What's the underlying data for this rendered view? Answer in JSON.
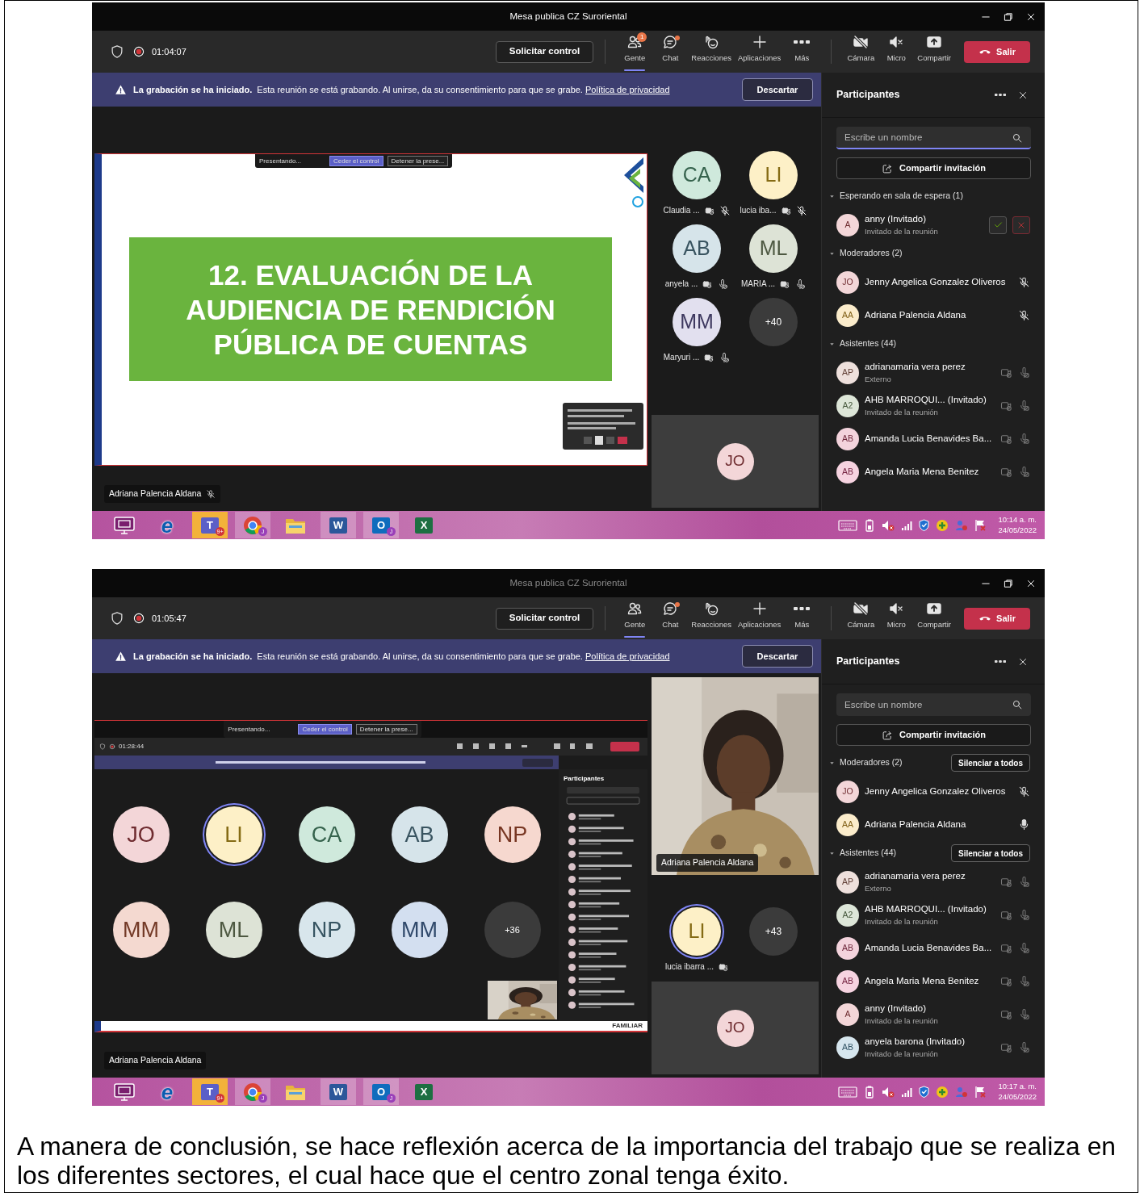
{
  "windows": [
    {
      "title": "Mesa publica CZ Suroriental",
      "active": true,
      "timer": "01:04:07",
      "control_button": "Solicitar control",
      "tools": [
        {
          "label": "Gente",
          "badge": "1",
          "unread": false,
          "selected": true
        },
        {
          "label": "Chat",
          "unread": true,
          "selected": false
        },
        {
          "label": "Reacciones",
          "unread": false,
          "selected": false
        },
        {
          "label": "Aplicaciones",
          "unread": false,
          "selected": false
        },
        {
          "label": "Más",
          "unread": false,
          "selected": false
        }
      ],
      "devices": [
        {
          "label": "Cámara"
        },
        {
          "label": "Micro"
        },
        {
          "label": "Compartir"
        }
      ],
      "leave_button": "Salir",
      "banner": {
        "title": "La grabación se ha iniciado.",
        "text": "Esta reunión se está grabando. Al unirse, da su consentimiento para que se grabe.",
        "link": "Política de privacidad",
        "button": "Descartar"
      },
      "stage": {
        "kind": "slide",
        "presenter_bar": {
          "label": "Presentando...",
          "buttons": [
            "Ceder el control",
            "Detener la prese..."
          ]
        },
        "heading": "12. EVALUACIÓN DE LA AUDIENCIA DE RENDICIÓN PÚBLICA DE CUENTAS"
      },
      "name_tag": {
        "name": "Adriana Palencia Aldana",
        "muted": true
      },
      "side": [
        {
          "kind": "grid",
          "overflow": "+40",
          "tiles": [
            {
              "initials": "CA",
              "name": "Claudia ...",
              "color": "#cfe9dc",
              "muted": true,
              "speaking": false
            },
            {
              "initials": "LI",
              "name": "lucia iba...",
              "color": "#fdf0c7",
              "muted": true,
              "speaking": false
            },
            {
              "initials": "AB",
              "name": "anyela ...",
              "color": "#d6e4ea",
              "muted": false,
              "speaking": false
            },
            {
              "initials": "ML",
              "name": "MARIA ...",
              "color": "#dde3d6",
              "muted": false,
              "speaking": false
            },
            {
              "initials": "MM",
              "name": "Maryuri ...",
              "color": "#e2e0ef",
              "muted": false,
              "speaking": false
            }
          ]
        },
        {
          "kind": "self",
          "initials": "JO",
          "color": "#f3d6d8"
        }
      ],
      "panel": {
        "title": "Participantes",
        "search": {
          "placeholder": "Escribe un nombre",
          "focused": true
        },
        "share_button": "Compartir invitación",
        "sections": [
          {
            "title": "Esperando en sala de espera (1)",
            "expanded": true,
            "people": [
              {
                "kind": "waiting",
                "initials": "A",
                "name": "anny (Invitado)",
                "role": "Invitado de la reunión",
                "color": "#f3d6d8"
              }
            ]
          },
          {
            "title": "Moderadores (2)",
            "expanded": true,
            "people": [
              {
                "kind": "moderator",
                "initials": "JO",
                "name": "Jenny Angelica Gonzalez Oliveros",
                "color": "#f3d6d8",
                "muted": true
              },
              {
                "kind": "moderator",
                "initials": "AA",
                "name": "Adriana Palencia Aldana",
                "color": "#fbeccb",
                "muted": true
              }
            ]
          },
          {
            "title": "Asistentes (44)",
            "expanded": true,
            "people": [
              {
                "kind": "attendee",
                "initials": "AP",
                "name": "adrianamaria vera perez",
                "role": "Externo",
                "color": "#eee0dc"
              },
              {
                "kind": "attendee",
                "initials": "A2",
                "name": "AHB MARROQUI... (Invitado)",
                "role": "Invitado de la reunión",
                "color": "#dde6d8"
              },
              {
                "kind": "attendee",
                "initials": "AB",
                "name": "Amanda Lucia Benavides Ba...",
                "color": "#f3d3dc"
              },
              {
                "kind": "attendee",
                "initials": "AB",
                "name": "Angela Maria Mena Benitez",
                "color": "#f6d3e0"
              }
            ]
          }
        ]
      },
      "taskbar": {
        "time": "10:14 a. m.",
        "date": "24/05/2022",
        "apps": [
          {
            "kind": "monitor",
            "running": false,
            "selected": false
          },
          {
            "kind": "glyph",
            "glyph": "e",
            "color": "#0b5cb0",
            "running": false,
            "selected": false
          },
          {
            "kind": "tile",
            "glyph": "T",
            "badge": "9+",
            "color": "#5b5fc7",
            "running": true,
            "selected": true
          },
          {
            "kind": "wheel",
            "badge": "J",
            "running": true,
            "selected": false
          },
          {
            "kind": "folder",
            "running": false,
            "selected": false
          },
          {
            "kind": "tile",
            "glyph": "W",
            "color": "#2b579a",
            "running": true,
            "selected": false
          },
          {
            "kind": "tile",
            "glyph": "O",
            "badge": "J",
            "color": "#0f6cbd",
            "running": true,
            "selected": false
          },
          {
            "kind": "tile",
            "glyph": "X",
            "color": "#1d6f42",
            "running": false,
            "selected": false
          }
        ]
      }
    },
    {
      "title": "Mesa publica CZ Suroriental",
      "active": false,
      "timer": "01:05:47",
      "control_button": "Solicitar control",
      "tools": [
        {
          "label": "Gente",
          "unread": false,
          "selected": true
        },
        {
          "label": "Chat",
          "unread": true,
          "selected": false
        },
        {
          "label": "Reacciones",
          "unread": false,
          "selected": false
        },
        {
          "label": "Aplicaciones",
          "unread": false,
          "selected": false
        },
        {
          "label": "Más",
          "unread": false,
          "selected": false
        }
      ],
      "devices": [
        {
          "label": "Cámara"
        },
        {
          "label": "Micro"
        },
        {
          "label": "Compartir"
        }
      ],
      "leave_button": "Salir",
      "banner": {
        "title": "La grabación se ha iniciado.",
        "text": "Esta reunión se está grabando. Al unirse, da su consentimiento para que se grabe.",
        "link": "Política de privacidad",
        "button": "Descartar"
      },
      "stage": {
        "kind": "shared_screen",
        "presenter_bar": {
          "label": "Presentando...",
          "buttons": [
            "Ceder el control",
            "Detener la prese..."
          ]
        },
        "timer": "01:28:44",
        "panel_title": "Participantes",
        "overflow": "+36",
        "footer": "FAMILIAR",
        "tiles": [
          {
            "initials": "JO",
            "color": "#f3d6d8",
            "speaking": false
          },
          {
            "initials": "LI",
            "color": "#fdf0c7",
            "speaking": true
          },
          {
            "initials": "CA",
            "color": "#cfe9dc",
            "speaking": false
          },
          {
            "initials": "AB",
            "color": "#d6e4ea",
            "speaking": false
          },
          {
            "initials": "NP",
            "color": "#f6d8cf",
            "speaking": false
          },
          {
            "initials": "MM",
            "color": "#f4d9d0",
            "speaking": false
          },
          {
            "initials": "ML",
            "color": "#dde3d6",
            "speaking": false
          },
          {
            "initials": "NP",
            "color": "#d8e6ec",
            "speaking": false
          },
          {
            "initials": "MM",
            "color": "#d3dff0",
            "speaking": false
          }
        ]
      },
      "name_tag": {
        "name": "Adriana Palencia Aldana",
        "muted": false
      },
      "side": [
        {
          "kind": "video",
          "name": "Adriana Palencia Aldana"
        },
        {
          "kind": "grid",
          "overflow": "+43",
          "tiles": [
            {
              "initials": "LI",
              "name": "lucia ibarra ...",
              "color": "#fdf0c7",
              "speaking": true
            }
          ]
        },
        {
          "kind": "self",
          "initials": "JO",
          "color": "#f3d6d8"
        }
      ],
      "panel": {
        "title": "Participantes",
        "search": {
          "placeholder": "Escribe un nombre",
          "focused": false
        },
        "share_button": "Compartir invitación",
        "sections": [
          {
            "title": "Moderadores (2)",
            "expanded": true,
            "action": "Silenciar a todos",
            "people": [
              {
                "kind": "moderator",
                "initials": "JO",
                "name": "Jenny Angelica Gonzalez Oliveros",
                "color": "#f3d6d8",
                "muted": true
              },
              {
                "kind": "moderator",
                "initials": "AA",
                "name": "Adriana Palencia Aldana",
                "color": "#fbeccb",
                "muted": false
              }
            ]
          },
          {
            "title": "Asistentes (44)",
            "expanded": true,
            "action": "Silenciar a todos",
            "people": [
              {
                "kind": "attendee",
                "initials": "AP",
                "name": "adrianamaria vera perez",
                "role": "Externo",
                "color": "#eee0dc"
              },
              {
                "kind": "attendee",
                "initials": "A2",
                "name": "AHB MARROQUI... (Invitado)",
                "role": "Invitado de la reunión",
                "color": "#dde6d8"
              },
              {
                "kind": "attendee",
                "initials": "AB",
                "name": "Amanda Lucia Benavides Ba...",
                "color": "#f3d3dc"
              },
              {
                "kind": "attendee",
                "initials": "AB",
                "name": "Angela Maria Mena Benitez",
                "color": "#f6d3e0"
              },
              {
                "kind": "attendee",
                "initials": "A",
                "name": "anny (Invitado)",
                "role": "Invitado de la reunión",
                "color": "#f3d6d8"
              },
              {
                "kind": "attendee",
                "initials": "AB",
                "name": "anyela barona (Invitado)",
                "role": "Invitado de la reunión",
                "color": "#d6e6ee"
              }
            ]
          }
        ]
      },
      "taskbar": {
        "time": "10:17 a. m.",
        "date": "24/05/2022",
        "apps": [
          {
            "kind": "monitor",
            "running": false,
            "selected": false
          },
          {
            "kind": "glyph",
            "glyph": "e",
            "color": "#0b5cb0",
            "running": false,
            "selected": false
          },
          {
            "kind": "tile",
            "glyph": "T",
            "badge": "9+",
            "color": "#5b5fc7",
            "running": true,
            "selected": true
          },
          {
            "kind": "wheel",
            "badge": "J",
            "running": true,
            "selected": false
          },
          {
            "kind": "folder",
            "running": false,
            "selected": false
          },
          {
            "kind": "tile",
            "glyph": "W",
            "color": "#2b579a",
            "running": true,
            "selected": false
          },
          {
            "kind": "tile",
            "glyph": "O",
            "badge": "J",
            "color": "#0f6cbd",
            "running": true,
            "selected": false
          },
          {
            "kind": "tile",
            "glyph": "X",
            "color": "#1d6f42",
            "running": false,
            "selected": false
          }
        ]
      }
    }
  ],
  "caption": "A manera de conclusión, se hace reflexión acerca de la importancia del trabajo que se realiza en los diferentes sectores, el cual hace que el centro zonal tenga éxito."
}
